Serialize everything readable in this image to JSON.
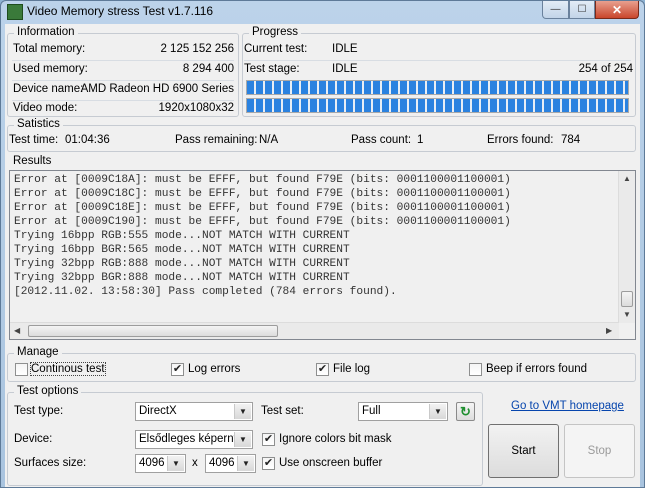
{
  "window": {
    "title": "Video Memory stress Test v1.7.116"
  },
  "information": {
    "label": "Information",
    "rows": [
      {
        "label": "Total memory:",
        "value": "2 125 152 256"
      },
      {
        "label": "Used memory:",
        "value": "8 294 400"
      },
      {
        "label": "Device name:",
        "value": "AMD Radeon HD 6900 Series"
      },
      {
        "label": "Video mode:",
        "value": "1920x1080x32"
      }
    ]
  },
  "progress": {
    "label": "Progress",
    "current_test_label": "Current test:",
    "current_test_value": "IDLE",
    "test_stage_label": "Test stage:",
    "test_stage_value": "IDLE",
    "stage_count": "254 of 254",
    "bar1_fraction": 1.0,
    "bar2_fraction": 1.0
  },
  "statistics": {
    "label": "Satistics",
    "test_time_label": "Test time:",
    "test_time_value": "01:04:36",
    "pass_remaining_label": "Pass remaining:",
    "pass_remaining_value": "N/A",
    "pass_count_label": "Pass count:",
    "pass_count_value": "1",
    "errors_found_label": "Errors found:",
    "errors_found_value": "784"
  },
  "results": {
    "label": "Results",
    "lines": [
      "Error at [0009C18A]: must be EFFF, but found F79E (bits: 0001100001100001)",
      "Error at [0009C18C]: must be EFFF, but found F79E (bits: 0001100001100001)",
      "Error at [0009C18E]: must be EFFF, but found F79E (bits: 0001100001100001)",
      "Error at [0009C190]: must be EFFF, but found F79E (bits: 0001100001100001)",
      "Trying 16bpp RGB:555 mode...NOT MATCH WITH CURRENT",
      "Trying 16bpp BGR:565 mode...NOT MATCH WITH CURRENT",
      "Trying 32bpp RGB:888 mode...NOT MATCH WITH CURRENT",
      "Trying 32bpp BGR:888 mode...NOT MATCH WITH CURRENT",
      "[2012.11.02. 13:58:30] Pass completed (784 errors found)."
    ]
  },
  "manage": {
    "label": "Manage",
    "continous_test": {
      "label": "Continous test",
      "checked": false
    },
    "log_errors": {
      "label": "Log errors",
      "checked": true
    },
    "file_log": {
      "label": "File log",
      "checked": true
    },
    "beep_if_errors": {
      "label": "Beep if errors found",
      "checked": false
    }
  },
  "test_options": {
    "label": "Test options",
    "test_type_label": "Test type:",
    "test_type_value": "DirectX",
    "test_set_label": "Test set:",
    "test_set_value": "Full",
    "device_label": "Device:",
    "device_value": "Elsődleges képernyő",
    "ignore_colors": {
      "label": "Ignore colors bit mask",
      "checked": true
    },
    "surfaces_label": "Surfaces size:",
    "surface_w": "4096",
    "surface_x": "x",
    "surface_h": "4096",
    "onscreen": {
      "label": "Use onscreen buffer",
      "checked": true
    }
  },
  "link": {
    "label": "Go to VMT homepage"
  },
  "buttons": {
    "start": "Start",
    "stop": "Stop"
  },
  "icons": {
    "check": "✔",
    "arrow_down": "▼",
    "refresh": "↻"
  }
}
